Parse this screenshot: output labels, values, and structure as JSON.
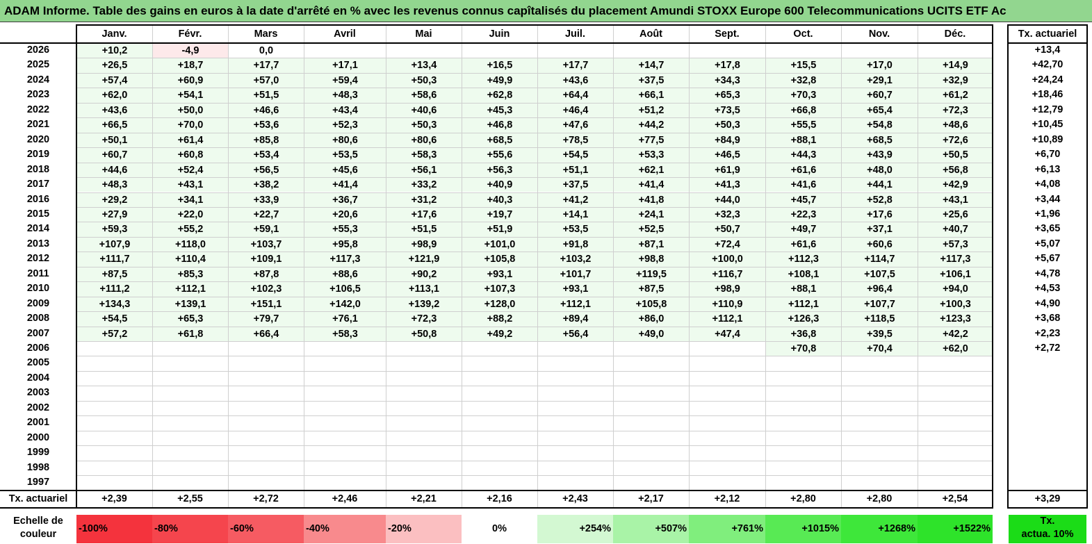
{
  "title": "ADAM Informe. Table des gains en euros à la date d'arrêté en % avec les revenus connus capîtalisés du placement Amundi STOXX Europe 600 Telecommunications UCITS ETF Ac",
  "months": [
    "Janv.",
    "Févr.",
    "Mars",
    "Avril",
    "Mai",
    "Juin",
    "Juil.",
    "Août",
    "Sept.",
    "Oct.",
    "Nov.",
    "Déc."
  ],
  "tx_header": "Tx. actuariel",
  "rows": [
    {
      "year": "2026",
      "values": [
        "+10,2",
        "-4,9",
        "0,0",
        "",
        "",
        "",
        "",
        "",
        "",
        "",
        "",
        ""
      ],
      "tx": "+13,4"
    },
    {
      "year": "2025",
      "values": [
        "+26,5",
        "+18,7",
        "+17,7",
        "+17,1",
        "+13,4",
        "+16,5",
        "+17,7",
        "+14,7",
        "+17,8",
        "+15,5",
        "+17,0",
        "+14,9"
      ],
      "tx": "+42,70"
    },
    {
      "year": "2024",
      "values": [
        "+57,4",
        "+60,9",
        "+57,0",
        "+59,4",
        "+50,3",
        "+49,9",
        "+43,6",
        "+37,5",
        "+34,3",
        "+32,8",
        "+29,1",
        "+32,9"
      ],
      "tx": "+24,24"
    },
    {
      "year": "2023",
      "values": [
        "+62,0",
        "+54,1",
        "+51,5",
        "+48,3",
        "+58,6",
        "+62,8",
        "+64,4",
        "+66,1",
        "+65,3",
        "+70,3",
        "+60,7",
        "+61,2"
      ],
      "tx": "+18,46"
    },
    {
      "year": "2022",
      "values": [
        "+43,6",
        "+50,0",
        "+46,6",
        "+43,4",
        "+40,6",
        "+45,3",
        "+46,4",
        "+51,2",
        "+73,5",
        "+66,8",
        "+65,4",
        "+72,3"
      ],
      "tx": "+12,79"
    },
    {
      "year": "2021",
      "values": [
        "+66,5",
        "+70,0",
        "+53,6",
        "+52,3",
        "+50,3",
        "+46,8",
        "+47,6",
        "+44,2",
        "+50,3",
        "+55,5",
        "+54,8",
        "+48,6"
      ],
      "tx": "+10,45"
    },
    {
      "year": "2020",
      "values": [
        "+50,1",
        "+61,4",
        "+85,8",
        "+80,6",
        "+80,6",
        "+68,5",
        "+78,5",
        "+77,5",
        "+84,9",
        "+88,1",
        "+68,5",
        "+72,6"
      ],
      "tx": "+10,89"
    },
    {
      "year": "2019",
      "values": [
        "+60,7",
        "+60,8",
        "+53,4",
        "+53,5",
        "+58,3",
        "+55,6",
        "+54,5",
        "+53,3",
        "+46,5",
        "+44,3",
        "+43,9",
        "+50,5"
      ],
      "tx": "+6,70"
    },
    {
      "year": "2018",
      "values": [
        "+44,6",
        "+52,4",
        "+56,5",
        "+45,6",
        "+56,1",
        "+56,3",
        "+51,1",
        "+62,1",
        "+61,9",
        "+61,6",
        "+48,0",
        "+56,8"
      ],
      "tx": "+6,13"
    },
    {
      "year": "2017",
      "values": [
        "+48,3",
        "+43,1",
        "+38,2",
        "+41,4",
        "+33,2",
        "+40,9",
        "+37,5",
        "+41,4",
        "+41,3",
        "+41,6",
        "+44,1",
        "+42,9"
      ],
      "tx": "+4,08"
    },
    {
      "year": "2016",
      "values": [
        "+29,2",
        "+34,1",
        "+33,9",
        "+36,7",
        "+31,2",
        "+40,3",
        "+41,2",
        "+41,8",
        "+44,0",
        "+45,7",
        "+52,8",
        "+43,1"
      ],
      "tx": "+3,44"
    },
    {
      "year": "2015",
      "values": [
        "+27,9",
        "+22,0",
        "+22,7",
        "+20,6",
        "+17,6",
        "+19,7",
        "+14,1",
        "+24,1",
        "+32,3",
        "+22,3",
        "+17,6",
        "+25,6"
      ],
      "tx": "+1,96"
    },
    {
      "year": "2014",
      "values": [
        "+59,3",
        "+55,2",
        "+59,1",
        "+55,3",
        "+51,5",
        "+51,9",
        "+53,5",
        "+52,5",
        "+50,7",
        "+49,7",
        "+37,1",
        "+40,7"
      ],
      "tx": "+3,65"
    },
    {
      "year": "2013",
      "values": [
        "+107,9",
        "+118,0",
        "+103,7",
        "+95,8",
        "+98,9",
        "+101,0",
        "+91,8",
        "+87,1",
        "+72,4",
        "+61,6",
        "+60,6",
        "+57,3"
      ],
      "tx": "+5,07"
    },
    {
      "year": "2012",
      "values": [
        "+111,7",
        "+110,4",
        "+109,1",
        "+117,3",
        "+121,9",
        "+105,8",
        "+103,2",
        "+98,8",
        "+100,0",
        "+112,3",
        "+114,7",
        "+117,3"
      ],
      "tx": "+5,67"
    },
    {
      "year": "2011",
      "values": [
        "+87,5",
        "+85,3",
        "+87,8",
        "+88,6",
        "+90,2",
        "+93,1",
        "+101,7",
        "+119,5",
        "+116,7",
        "+108,1",
        "+107,5",
        "+106,1"
      ],
      "tx": "+4,78"
    },
    {
      "year": "2010",
      "values": [
        "+111,2",
        "+112,1",
        "+102,3",
        "+106,5",
        "+113,1",
        "+107,3",
        "+93,1",
        "+87,5",
        "+98,9",
        "+88,1",
        "+96,4",
        "+94,0"
      ],
      "tx": "+4,53"
    },
    {
      "year": "2009",
      "values": [
        "+134,3",
        "+139,1",
        "+151,1",
        "+142,0",
        "+139,2",
        "+128,0",
        "+112,1",
        "+105,8",
        "+110,9",
        "+112,1",
        "+107,7",
        "+100,3"
      ],
      "tx": "+4,90"
    },
    {
      "year": "2008",
      "values": [
        "+54,5",
        "+65,3",
        "+79,7",
        "+76,1",
        "+72,3",
        "+88,2",
        "+89,4",
        "+86,0",
        "+112,1",
        "+126,3",
        "+118,5",
        "+123,3"
      ],
      "tx": "+3,68"
    },
    {
      "year": "2007",
      "values": [
        "+57,2",
        "+61,8",
        "+66,4",
        "+58,3",
        "+50,8",
        "+49,2",
        "+56,4",
        "+49,0",
        "+47,4",
        "+36,8",
        "+39,5",
        "+42,2"
      ],
      "tx": "+2,23"
    },
    {
      "year": "2006",
      "values": [
        "",
        "",
        "",
        "",
        "",
        "",
        "",
        "",
        "",
        "+70,8",
        "+70,4",
        "+62,0"
      ],
      "tx": "+2,72"
    },
    {
      "year": "2005",
      "values": [
        "",
        "",
        "",
        "",
        "",
        "",
        "",
        "",
        "",
        "",
        "",
        ""
      ],
      "tx": ""
    },
    {
      "year": "2004",
      "values": [
        "",
        "",
        "",
        "",
        "",
        "",
        "",
        "",
        "",
        "",
        "",
        ""
      ],
      "tx": ""
    },
    {
      "year": "2003",
      "values": [
        "",
        "",
        "",
        "",
        "",
        "",
        "",
        "",
        "",
        "",
        "",
        ""
      ],
      "tx": ""
    },
    {
      "year": "2002",
      "values": [
        "",
        "",
        "",
        "",
        "",
        "",
        "",
        "",
        "",
        "",
        "",
        ""
      ],
      "tx": ""
    },
    {
      "year": "2001",
      "values": [
        "",
        "",
        "",
        "",
        "",
        "",
        "",
        "",
        "",
        "",
        "",
        ""
      ],
      "tx": ""
    },
    {
      "year": "2000",
      "values": [
        "",
        "",
        "",
        "",
        "",
        "",
        "",
        "",
        "",
        "",
        "",
        ""
      ],
      "tx": ""
    },
    {
      "year": "1999",
      "values": [
        "",
        "",
        "",
        "",
        "",
        "",
        "",
        "",
        "",
        "",
        "",
        ""
      ],
      "tx": ""
    },
    {
      "year": "1998",
      "values": [
        "",
        "",
        "",
        "",
        "",
        "",
        "",
        "",
        "",
        "",
        "",
        ""
      ],
      "tx": ""
    },
    {
      "year": "1997",
      "values": [
        "",
        "",
        "",
        "",
        "",
        "",
        "",
        "",
        "",
        "",
        "",
        ""
      ],
      "tx": ""
    }
  ],
  "footer": {
    "label": "Tx. actuariel",
    "values": [
      "+2,39",
      "+2,55",
      "+2,72",
      "+2,46",
      "+2,21",
      "+2,16",
      "+2,43",
      "+2,17",
      "+2,12",
      "+2,80",
      "+2,80",
      "+2,54"
    ],
    "tx": "+3,29"
  },
  "scale": {
    "label_line1": "Echelle de",
    "label_line2": "couleur",
    "items": [
      {
        "text": "-100%",
        "bg": "#f4333d",
        "align": "left"
      },
      {
        "text": "-80%",
        "bg": "#f5454d",
        "align": "left"
      },
      {
        "text": "-60%",
        "bg": "#f65b62",
        "align": "left"
      },
      {
        "text": "-40%",
        "bg": "#f88a8d",
        "align": "left"
      },
      {
        "text": "-20%",
        "bg": "#fbbfc1",
        "align": "left"
      },
      {
        "text": "0%",
        "bg": "#ffffff",
        "align": "center"
      },
      {
        "text": "+254%",
        "bg": "#d3f8d2",
        "align": "right"
      },
      {
        "text": "+507%",
        "bg": "#a9f3a7",
        "align": "right"
      },
      {
        "text": "+761%",
        "bg": "#80ee7d",
        "align": "right"
      },
      {
        "text": "+1015%",
        "bg": "#58ea54",
        "align": "right"
      },
      {
        "text": "+1268%",
        "bg": "#3ee73a",
        "align": "right"
      },
      {
        "text": "+1522%",
        "bg": "#2ee32a",
        "align": "right"
      }
    ],
    "tx_line1": "Tx.",
    "tx_line2": "actua. 10%",
    "tx_bg": "#1bdc17"
  },
  "colors": {
    "title_bg": "#92d68f",
    "positive_tint": "#eefbee",
    "negative_tint": "#fde9ea"
  }
}
